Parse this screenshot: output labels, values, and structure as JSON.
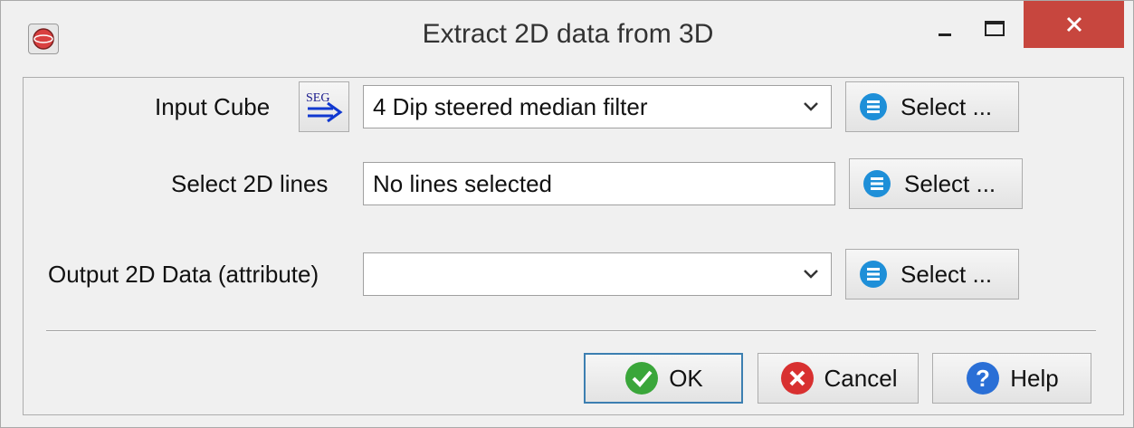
{
  "window": {
    "title": "Extract 2D data from 3D",
    "controls": [
      "minimize-icon",
      "maximize-icon",
      "close-icon"
    ],
    "close_color": "#c7463e"
  },
  "form": {
    "input_cube": {
      "label": "Input Cube",
      "icon_text": "SEG",
      "value": "4 Dip steered median filter",
      "select_label": "Select ..."
    },
    "lines": {
      "label": "Select 2D lines",
      "value": "No lines selected",
      "select_label": "Select ..."
    },
    "output": {
      "label": "Output 2D Data (attribute)",
      "value": "",
      "select_label": "Select ..."
    }
  },
  "buttons": {
    "ok": "OK",
    "cancel": "Cancel",
    "help": "Help"
  }
}
